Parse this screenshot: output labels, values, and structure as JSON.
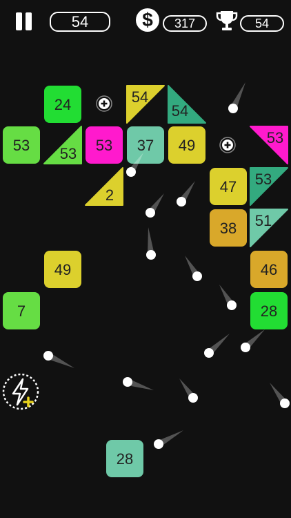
{
  "hud": {
    "score": "54",
    "coins": "317",
    "best": "54",
    "coin_symbol": "$"
  },
  "colors": {
    "background": "#111111",
    "green": "#22dd33",
    "lime": "#66dd44",
    "magenta": "#ff1acd",
    "teal": "#6fc9a8",
    "dark_teal": "#33aa7f",
    "yellow": "#dcd02d",
    "gold": "#d9a82a",
    "ball": "#ffffff"
  },
  "bricks": [
    {
      "value": "24",
      "shape": "square",
      "color": "#22dd33"
    },
    {
      "value": "54",
      "shape": "tri-tl",
      "color": "#dcd02d"
    },
    {
      "value": "54",
      "shape": "tri-bl",
      "color": "#33aa7f"
    },
    {
      "value": "53",
      "shape": "square",
      "color": "#66dd44"
    },
    {
      "value": "53",
      "shape": "tri-br",
      "color": "#66dd44"
    },
    {
      "value": "53",
      "shape": "square",
      "color": "#ff1acd"
    },
    {
      "value": "37",
      "shape": "square",
      "color": "#6fc9a8"
    },
    {
      "value": "49",
      "shape": "square",
      "color": "#dcd02d"
    },
    {
      "value": "53",
      "shape": "tri-tr",
      "color": "#ff1acd"
    },
    {
      "value": "2",
      "shape": "tri-br",
      "color": "#dcd02d"
    },
    {
      "value": "47",
      "shape": "square",
      "color": "#dcd02d"
    },
    {
      "value": "53",
      "shape": "tri-tl",
      "color": "#33aa7f"
    },
    {
      "value": "38",
      "shape": "square",
      "color": "#d9a82a"
    },
    {
      "value": "51",
      "shape": "tri-tl",
      "color": "#6fc9a8"
    },
    {
      "value": "49",
      "shape": "square",
      "color": "#dcd02d"
    },
    {
      "value": "46",
      "shape": "square",
      "color": "#d9a82a"
    },
    {
      "value": "7",
      "shape": "square",
      "color": "#66dd44"
    },
    {
      "value": "28",
      "shape": "square",
      "color": "#22dd33"
    },
    {
      "value": "28",
      "shape": "square",
      "color": "#6fc9a8"
    }
  ],
  "extra_ball_pickups": 2,
  "balls_in_flight": 13,
  "icons": {
    "pause": "pause-icon",
    "coin": "dollar-coin-icon",
    "trophy": "trophy-icon",
    "lightning": "lightning-powerup-icon",
    "pickup": "plus-ball-icon"
  }
}
